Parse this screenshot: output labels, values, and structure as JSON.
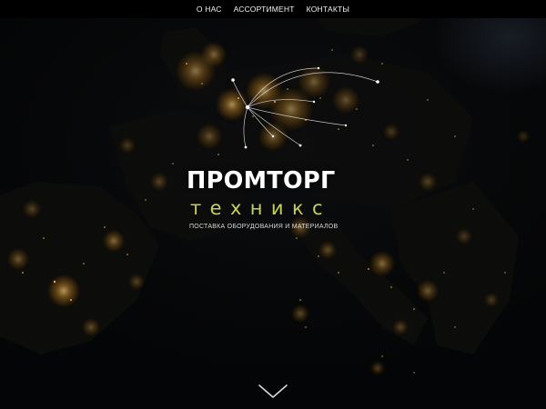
{
  "nav": {
    "items": [
      {
        "label": "О НАС"
      },
      {
        "label": "АССОРТИМЕНТ"
      },
      {
        "label": "КОНТАКТЫ"
      }
    ]
  },
  "brand": {
    "title": "ПРОМТОРГ",
    "subtitle": "техникс",
    "tagline": "ПОСТАВКА ОБОРУДОВАНИЯ И МАТЕРИАЛОВ"
  },
  "colors": {
    "nav_bg": "#000000",
    "text": "#ffffff",
    "accent": "#c7cf5a",
    "city_lights": "#ffb43a"
  },
  "icons": {
    "scroll": "chevron-down-icon"
  }
}
